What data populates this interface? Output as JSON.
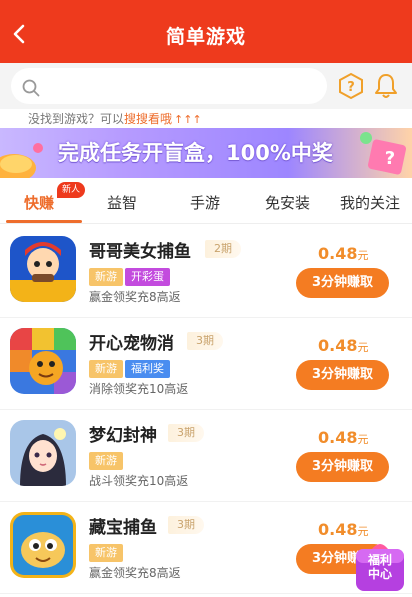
{
  "header": {
    "title": "简单游戏"
  },
  "search": {
    "placeholder": ""
  },
  "hint": {
    "prefix": "没找到游戏？可以",
    "link": "搜搜看哦",
    "arrows": "↑↑↑"
  },
  "banner": {
    "text": "完成任务开盲盒，100%中奖"
  },
  "tabs": [
    {
      "label": "快赚",
      "active": true
    },
    {
      "label": "益智"
    },
    {
      "label": "手游"
    },
    {
      "label": "免安装"
    },
    {
      "label": "我的关注"
    }
  ],
  "new_badge": "新人",
  "games": [
    {
      "name": "哥哥美女捕鱼",
      "period": "2期",
      "tags": [
        "新游",
        "开彩蛋"
      ],
      "desc": "赢金领奖充8高返",
      "price": "0.48",
      "unit": "元",
      "button": "3分钟赚取"
    },
    {
      "name": "开心宠物消",
      "period": "3期",
      "tags": [
        "新游",
        "福利奖"
      ],
      "desc": "消除领奖充10高返",
      "price": "0.48",
      "unit": "元",
      "button": "3分钟赚取"
    },
    {
      "name": "梦幻封神",
      "period": "3期",
      "tags": [
        "新游"
      ],
      "desc": "战斗领奖充10高返",
      "price": "0.48",
      "unit": "元",
      "button": "3分钟赚取"
    },
    {
      "name": "藏宝捕鱼",
      "period": "3期",
      "tags": [
        "新游"
      ],
      "desc": "赢金领奖充8高返",
      "price": "0.48",
      "unit": "元",
      "button": "3分钟赚取"
    }
  ],
  "welfare": {
    "line1": "福利",
    "line2": "中心"
  },
  "colors": {
    "header": "#ee3a1d",
    "accent": "#ee6d2c",
    "button": "#f47c22",
    "price": "#f18d2b"
  },
  "icons": {
    "back": "chevron-left-icon",
    "search": "search-icon",
    "help": "question-hexagon-icon",
    "bell": "bell-icon"
  }
}
